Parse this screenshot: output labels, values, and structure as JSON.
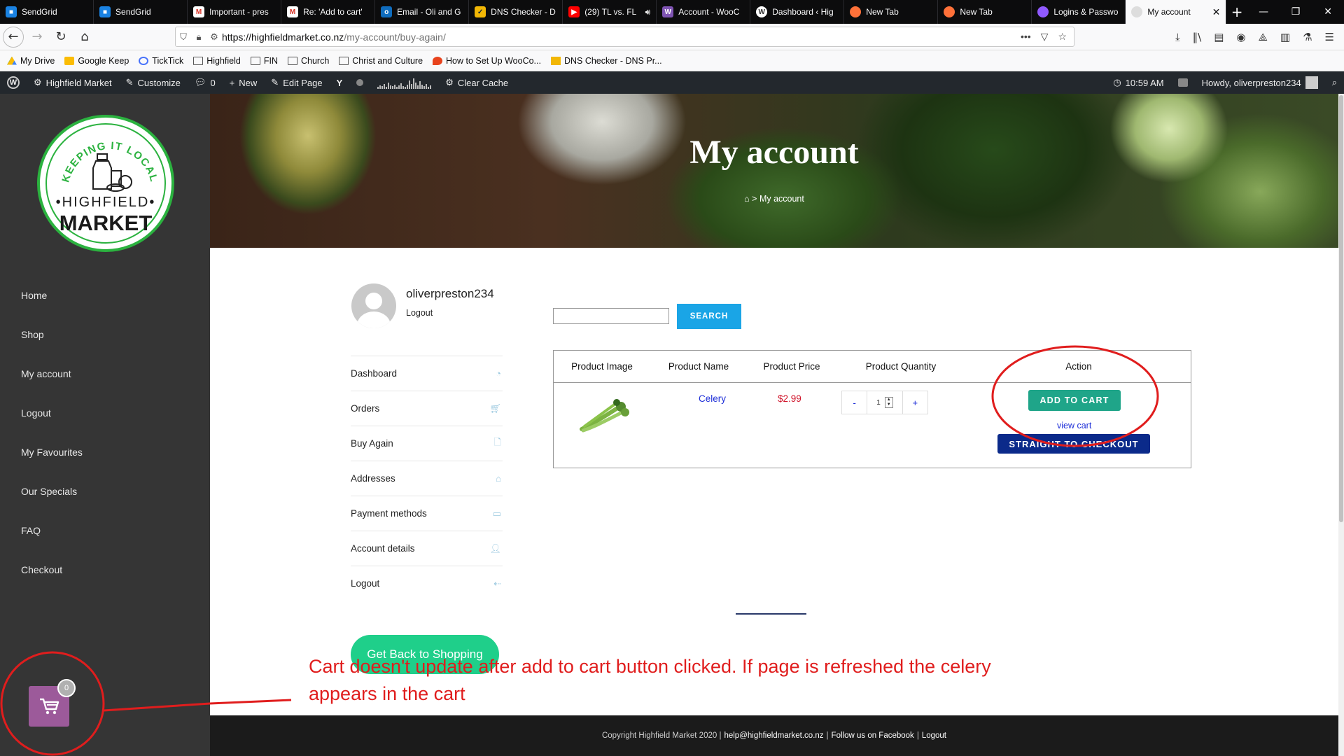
{
  "browser": {
    "tabs": [
      {
        "label": "SendGrid",
        "icon": "sendgrid-icon",
        "color": "#1a82e2"
      },
      {
        "label": "SendGrid",
        "icon": "sendgrid-icon",
        "color": "#1a82e2"
      },
      {
        "label": "Important - pres",
        "icon": "gmail-icon",
        "color": "#d93025"
      },
      {
        "label": "Re: 'Add to cart'",
        "icon": "gmail-icon",
        "color": "#d93025"
      },
      {
        "label": "Email - Oli and G",
        "icon": "outlook-icon",
        "color": "#0f6cbd"
      },
      {
        "label": "DNS Checker - D",
        "icon": "dns-checker-icon",
        "color": "#f2b705"
      },
      {
        "label": "(29) TL vs. FL",
        "icon": "youtube-icon",
        "color": "#ff0000"
      },
      {
        "label": "Account - WooC",
        "icon": "woocommerce-icon",
        "color": "#7f54b3"
      },
      {
        "label": "Dashboard ‹ Hig",
        "icon": "wordpress-icon",
        "color": "#ffffff"
      },
      {
        "label": "New Tab",
        "icon": "firefox-icon",
        "color": "#ff7139"
      },
      {
        "label": "New Tab",
        "icon": "firefox-icon",
        "color": "#ff7139"
      },
      {
        "label": "Logins & Passwo",
        "icon": "lockwise-icon",
        "color": "#9059ff"
      },
      {
        "label": "My account",
        "icon": "page-icon",
        "color": "#888888",
        "active": true
      }
    ],
    "url_host": "https://highfieldmarket.co.nz",
    "url_path": "/my-account/buy-again/",
    "bookmarks": [
      {
        "label": "My Drive",
        "icon": "google-drive-icon",
        "color": "#0f9d58"
      },
      {
        "label": "Google Keep",
        "icon": "google-keep-icon",
        "color": "#fbbc04"
      },
      {
        "label": "TickTick",
        "icon": "ticktick-icon",
        "color": "#4772fa"
      },
      {
        "label": "Highfield",
        "icon": "folder-icon"
      },
      {
        "label": "FIN",
        "icon": "folder-icon"
      },
      {
        "label": "Church",
        "icon": "folder-icon"
      },
      {
        "label": "Christ and Culture",
        "icon": "folder-icon"
      },
      {
        "label": "How to Set Up WooCo...",
        "icon": "flame-icon",
        "color": "#e8431d"
      },
      {
        "label": "DNS Checker - DNS Pr...",
        "icon": "dns-checker-icon",
        "color": "#f2b705"
      }
    ]
  },
  "adminbar": {
    "site_name": "Highfield Market",
    "customize": "Customize",
    "comments_count": "0",
    "new_label": "New",
    "edit_page": "Edit Page",
    "clear_cache": "Clear Cache",
    "time": "10:59 AM",
    "howdy": "Howdy, oliverpreston234"
  },
  "sidebar": {
    "logo": {
      "arc_text": "KEEPING IT LOCAL",
      "line1": "•HIGHFIELD•",
      "line2": "MARKET",
      "green": "#2bb23f"
    },
    "menu": [
      "Home",
      "Shop",
      "My account",
      "Logout",
      "My Favourites",
      "Our Specials",
      "FAQ",
      "Checkout"
    ]
  },
  "hero": {
    "title": "My account",
    "breadcrumb_current": "My account"
  },
  "profile": {
    "username": "oliverpreston234",
    "logout": "Logout"
  },
  "account_nav": [
    {
      "label": "Dashboard",
      "icon": "dashboard-icon"
    },
    {
      "label": "Orders",
      "icon": "cart-icon"
    },
    {
      "label": "Buy Again",
      "icon": "file-icon"
    },
    {
      "label": "Addresses",
      "icon": "home-icon"
    },
    {
      "label": "Payment methods",
      "icon": "credit-card-icon"
    },
    {
      "label": "Account details",
      "icon": "user-icon"
    },
    {
      "label": "Logout",
      "icon": "logout-icon"
    }
  ],
  "search": {
    "value": "",
    "button": "SEARCH"
  },
  "table": {
    "headers": [
      "Product Image",
      "Product Name",
      "Product Price",
      "Product Quantity",
      "Action"
    ],
    "row": {
      "name": "Celery",
      "price": "$2.99",
      "qty_minus": "-",
      "qty": "1",
      "qty_plus": "+",
      "add_to_cart": "ADD TO CART",
      "view_cart": "view cart",
      "checkout": "STRAIGHT TO CHECKOUT"
    }
  },
  "back_button": "Get Back to Shopping",
  "cart": {
    "count": "0"
  },
  "footer": {
    "copyright": "Copyright Highfield Market 2020 |",
    "email": "help@highfieldmarket.co.nz",
    "sep1": "|",
    "facebook": "Follow us on Facebook",
    "sep2": "|",
    "logout": "Logout"
  },
  "annotation": {
    "note": "Cart doesn't update after add to cart button clicked.  If page is refreshed the celery appears in the cart",
    "color": "#e01d1d"
  },
  "colors": {
    "search_button": "#1aa5e6",
    "add_to_cart": "#1fa589",
    "checkout": "#0b2a8a",
    "back_button": "#1fcf8a",
    "price": "#d0142a",
    "cart_widget": "#9c5a9a"
  }
}
